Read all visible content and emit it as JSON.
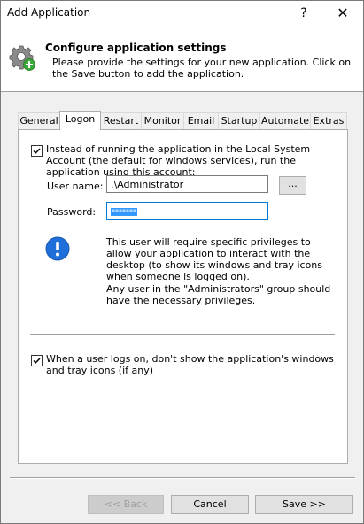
{
  "window": {
    "title": "Add Application",
    "help_label": "?",
    "close_label": "✕"
  },
  "header": {
    "title": "Configure application settings",
    "description": "Please provide the settings for your new application. Click on the Save button to add the application."
  },
  "tabs": [
    {
      "label": "General"
    },
    {
      "label": "Logon",
      "active": true
    },
    {
      "label": "Restart"
    },
    {
      "label": "Monitor"
    },
    {
      "label": "Email"
    },
    {
      "label": "Startup"
    },
    {
      "label": "Automate"
    },
    {
      "label": "Extras"
    }
  ],
  "logon": {
    "run_as_account_checked": true,
    "run_as_account_label": "Instead of running the application in the Local System Account (the default for windows services), run the application using this account:",
    "user_name_label": "User name:",
    "user_name_value": ".\\Administrator",
    "browse_label": "...",
    "password_label": "Password:",
    "password_masked": "*******",
    "info_text_1": "This user will require specific privileges to allow your application to interact with the desktop (to show its windows and tray icons when someone is logged on).",
    "info_text_2": "Any user in the \"Administrators\" group should have the necessary privileges.",
    "hide_windows_checked": true,
    "hide_windows_label": "When a user logs on, don't show the application's windows and tray icons (if any)"
  },
  "buttons": {
    "back_label": "<< Back",
    "cancel_label": "Cancel",
    "save_label": "Save >>"
  },
  "colors": {
    "accent": "#0078d7",
    "info_icon": "#1e6fd9",
    "selection": "#3399ff"
  }
}
